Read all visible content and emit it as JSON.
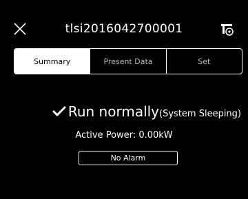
{
  "header": {
    "title": "tlsi2016042700001",
    "close_icon": "close-icon",
    "device_icon": "device-settings-icon"
  },
  "tabs": [
    {
      "label": "Summary",
      "active": true
    },
    {
      "label": "Present Data",
      "active": false
    },
    {
      "label": "Set",
      "active": false
    }
  ],
  "status": {
    "icon": "check-icon",
    "main": "Run normally",
    "sub": "(System Sleeping)"
  },
  "power": {
    "label": "Active Power:",
    "value": "0.00kW"
  },
  "alarm": {
    "label": "No Alarm"
  },
  "colors": {
    "background": "#000000",
    "foreground": "#FFFFFF",
    "tab_inactive_text": "#BBBBBB"
  }
}
